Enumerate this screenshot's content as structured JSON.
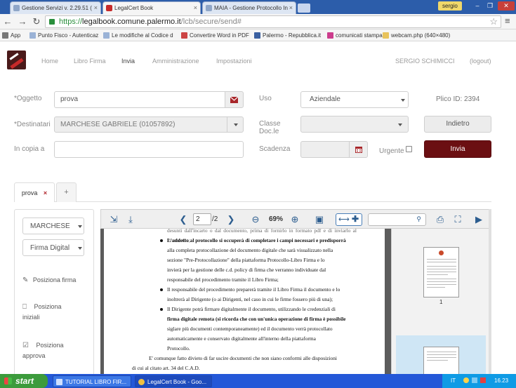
{
  "browser": {
    "tabs": [
      {
        "title": "Gestione Servizi v. 2.29.51 (",
        "active": false
      },
      {
        "title": "LegalCert Book",
        "active": true
      },
      {
        "title": "MAIA - Gestione Protocollo In",
        "active": false
      }
    ],
    "window_user": "sergio",
    "url_scheme": "https://",
    "url_host": "legalbook.comune.palermo.it",
    "url_path": "/lcb/secure/send#",
    "bookmarks": [
      "App",
      "Punto Fisco - Autenticaz",
      "Le modifiche al Codice d",
      "Convertire Word in PDF",
      "Palermo - Repubblica.it",
      "comunicati stampa",
      "webcam.php (640×480)"
    ]
  },
  "nav": {
    "items": [
      "Home",
      "Libro Firma",
      "Invia",
      "Amministrazione",
      "Impostazioni"
    ],
    "active": "Invia",
    "user": "SERGIO SCHIMICCI",
    "logout": "(logout)"
  },
  "form": {
    "oggetto_label": "*Oggetto",
    "oggetto_value": "prova",
    "destinatari_label": "*Destinatari",
    "destinatari_value": "MARCHESE GABRIELE (01057892)",
    "copia_label": "In copia a",
    "copia_value": "",
    "uso_label": "Uso",
    "uso_value": "Aziendale",
    "classe_label_1": "Classe",
    "classe_label_2": "Doc.le",
    "classe_value": "",
    "scadenza_label": "Scadenza",
    "scadenza_value": "",
    "urgente_label": "Urgente",
    "plico_id": "Plico ID: 2394",
    "indietro": "Indietro",
    "invia": "Invia"
  },
  "doc_tabs": {
    "active_label": "prova",
    "close": "×",
    "add": "+"
  },
  "side": {
    "signer": "MARCHESE",
    "sign_type": "Firma Digital",
    "posiziona_firma": "Posiziona firma",
    "posiziona_iniziali_1": "Posiziona",
    "posiziona_iniziali_2": "iniziali",
    "posiziona_approva_1": "Posiziona",
    "posiziona_approva_2": "approva"
  },
  "viewer": {
    "page": "2",
    "total": "/2",
    "zoom": "69%",
    "thumb_label": "1",
    "lines": [
      "desunti dall'incarto o dal documento, prima di fornirlo in formato pdf e di inviarlo al Protocollo;",
      "L'addetto al protocollo si occuperà di completare i campi necessari e predisporrà",
      "alla completa protocollazione del documento digitale che sarà visualizzato nella",
      "sezione \"Pre-Protocollazione\" della piattaforma Protocollo-Libro Firma e lo",
      "invierà per la gestione delle c.d. policy di firma che verranno individuate dal",
      "responsabile del procedimento tramite il Libro Firma;",
      "Il responsabile del procedimento preparerà tramite il Libro Firma il documento e lo",
      "inoltrerà al Dirigente (o ai Dirigenti, nel caso in cui le firme fossero più di una);",
      "Il Dirigente potrà firmare digitalmente il documento, utilizzando le credenziali di",
      "firma digitale remota (si ricorda che con un'unica operazione di firma è possibile",
      "siglare più documenti contemporaneamente) ed il documento verrà protocollato",
      "automaticamente e conservato digitalmente all'interno della piattaforma",
      "Protocollo.",
      "E' comunque fatto divieto di far uscire documenti che non siano conformi alle disposizioni",
      "di cui al citato art. 34 del C.A.D."
    ]
  },
  "taskbar": {
    "start": "start",
    "tasks": [
      "TUTORIAL LIBRO FIR...",
      "LegalCert Book - Goo..."
    ],
    "lang": "IT",
    "clock": "16.23"
  },
  "colors": {
    "brand": "#6b0f12",
    "accent_blue": "#2c5d8f",
    "nav_active": "#444444"
  }
}
